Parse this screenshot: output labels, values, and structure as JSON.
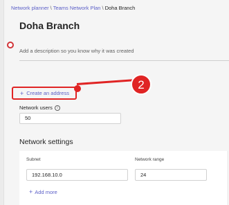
{
  "breadcrumb": {
    "items": [
      "Network planner",
      "Teams Network Plan",
      "Doha Branch"
    ],
    "separator": "\\"
  },
  "page": {
    "title": "Doha Branch",
    "description_placeholder": "Add a description so you know why it was created"
  },
  "actions": {
    "create_address_label": "Create an address",
    "add_more_label": "Add more"
  },
  "callout": {
    "number": "2",
    "color": "#e02424"
  },
  "network_users": {
    "label": "Network users",
    "value": "50"
  },
  "network_settings": {
    "title": "Network settings",
    "columns": [
      "Subnet",
      "Network range"
    ],
    "row": {
      "subnet": "192.168.10.0",
      "range": "24"
    }
  },
  "colors": {
    "link": "#5b5fc7",
    "annotation": "#e02424",
    "background": "#f5f5f5"
  }
}
